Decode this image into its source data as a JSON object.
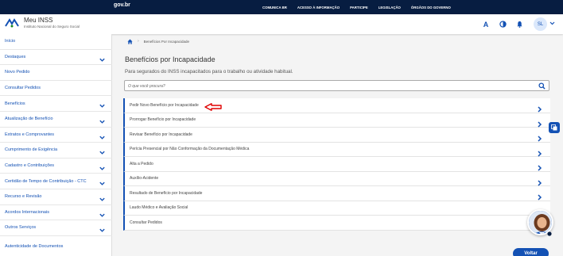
{
  "govbar": {
    "logo": "gov.br",
    "links": [
      "COMUNICA BR",
      "ACESSO À INFORMAÇÃO",
      "PARTICIPE",
      "LEGISLAÇÃO",
      "ÓRGÃOS DO GOVERNO"
    ]
  },
  "header": {
    "app_title": "Meu INSS",
    "app_subtitle": "Instituto Nacional do Seguro Social",
    "font_size_tool": "A",
    "avatar_initials": "SL"
  },
  "sidebar": {
    "items": [
      {
        "label": "Início",
        "expandable": false
      },
      {
        "label": "Destaques",
        "expandable": true
      },
      {
        "label": "Novo Pedido",
        "expandable": false
      },
      {
        "label": "Consultar Pedidos",
        "expandable": false
      },
      {
        "label": "Benefícios",
        "expandable": true
      },
      {
        "label": "Atualização de Benefício",
        "expandable": true
      },
      {
        "label": "Extratos e Comprovantes",
        "expandable": true
      },
      {
        "label": "Cumprimento de Exigência",
        "expandable": true
      },
      {
        "label": "Cadastro e Contribuições",
        "expandable": true
      },
      {
        "label": "Certidão de Tempo de Contribuição - CTC",
        "expandable": true
      },
      {
        "label": "Recurso e Revisão",
        "expandable": true
      },
      {
        "label": "Acordos Internacionais",
        "expandable": true
      },
      {
        "label": "Outros Serviços",
        "expandable": true
      }
    ],
    "bottom_link": "Autenticidade de Documentos"
  },
  "breadcrumb": {
    "current": "Benefícios Por Incapacidade"
  },
  "main": {
    "title": "Benefícios por Incapacidade",
    "subtitle": "Para segurados do INSS incapacitados para o trabalho ou atividade habitual.",
    "search_placeholder": "O que você procura?",
    "services": [
      "Pedir Novo Benefício por Incapacidade",
      "Prorrogar Benefício por Incapacidade",
      "Revisar Benefício por Incapacidade",
      "Perícia Presencial por Não Conformação da Documentação Médica",
      "Alta a Pedido",
      "Auxílio-Acidente",
      "Resultado de Benefício por Incapacidade",
      "Laudo Médico e Avaliação Social",
      "Consultar Pedidos"
    ],
    "back_label": "Voltar"
  },
  "colors": {
    "govbar": "#071d41",
    "primary": "#1351b4",
    "annotation_arrow": "#e00000"
  }
}
